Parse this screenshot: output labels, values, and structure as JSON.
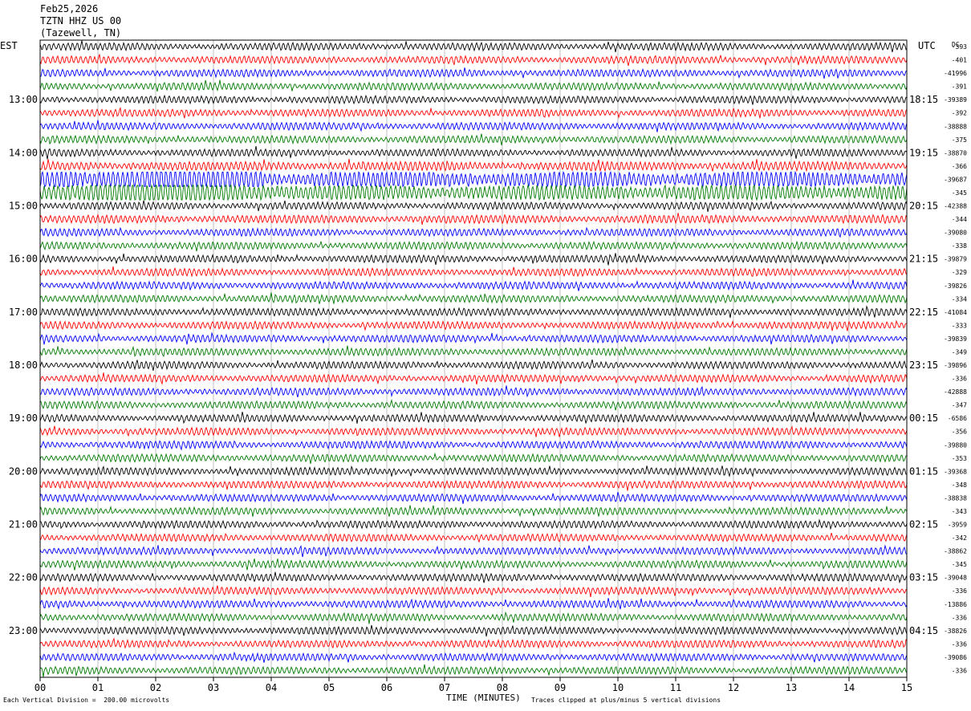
{
  "header": {
    "date": "Feb25,2026",
    "station": "TZTN HHZ US 00",
    "location": "(Tazewell, TN)"
  },
  "left_axis_label": "EST",
  "right_axis_label": "UTC",
  "dc_label": "DC",
  "footer": {
    "scale_text": "Each Vertical Division =  200.00 microvolts",
    "xlabel": "TIME (MINUTES)",
    "clip_text": "Traces clipped at plus/minus 5 vertical divisions"
  },
  "colors": {
    "trace_cycle": [
      "#000000",
      "#ff0000",
      "#0000ff",
      "#007a00"
    ],
    "grid": "#b0b0b0",
    "frame": "#000000"
  },
  "chart_data": {
    "type": "line",
    "title": "",
    "xlabel": "TIME (MINUTES)",
    "ylabel": "",
    "xlim": [
      0,
      15
    ],
    "x_ticks": [
      "00",
      "01",
      "02",
      "03",
      "04",
      "05",
      "06",
      "07",
      "08",
      "09",
      "10",
      "11",
      "12",
      "13",
      "14",
      "15"
    ],
    "vertical_grid": true,
    "rows_per_hour": 4,
    "minutes_per_row": 15,
    "left_time_labels": [
      {
        "row": 4,
        "label": "13:00"
      },
      {
        "row": 8,
        "label": "14:00"
      },
      {
        "row": 12,
        "label": "15:00"
      },
      {
        "row": 16,
        "label": "16:00"
      },
      {
        "row": 20,
        "label": "17:00"
      },
      {
        "row": 24,
        "label": "18:00"
      },
      {
        "row": 28,
        "label": "19:00"
      },
      {
        "row": 32,
        "label": "20:00"
      },
      {
        "row": 36,
        "label": "21:00"
      },
      {
        "row": 40,
        "label": "22:00"
      },
      {
        "row": 44,
        "label": "23:00"
      }
    ],
    "right_time_labels": [
      {
        "row": 4,
        "label": "18:15"
      },
      {
        "row": 8,
        "label": "19:15"
      },
      {
        "row": 12,
        "label": "20:15"
      },
      {
        "row": 16,
        "label": "21:15"
      },
      {
        "row": 20,
        "label": "22:15"
      },
      {
        "row": 24,
        "label": "23:15"
      },
      {
        "row": 28,
        "label": "00:15"
      },
      {
        "row": 32,
        "label": "01:15"
      },
      {
        "row": 36,
        "label": "02:15"
      },
      {
        "row": 40,
        "label": "03:15"
      },
      {
        "row": 44,
        "label": "04:15"
      }
    ],
    "dc_offsets": [
      "-393",
      "-401",
      "-41996",
      "-391",
      "-39389",
      "-392",
      "-38888",
      "-375",
      "-38870",
      "-366",
      "-39687",
      "-345",
      "-42388",
      "-344",
      "-39080",
      "-338",
      "-39879",
      "-329",
      "-39826",
      "-334",
      "-41084",
      "-333",
      "-39839",
      "-349",
      "-39896",
      "-336",
      "-42888",
      "-347",
      "-6586",
      "-356",
      "-39880",
      "-353",
      "-39368",
      "-348",
      "-38838",
      "-343",
      "-3959",
      "-342",
      "-38862",
      "-345",
      "-39048",
      "-336",
      "-13886",
      "-336",
      "-38826",
      "-336",
      "-39086",
      "-336"
    ],
    "row_amplitude": [
      1,
      1,
      1,
      1,
      1,
      1,
      1,
      1,
      1,
      1.2,
      2.2,
      2.1,
      1,
      1.1,
      1,
      1,
      1,
      1,
      1,
      1,
      1,
      1,
      1,
      1,
      1,
      1,
      1,
      1,
      1,
      1,
      1,
      1,
      1,
      1,
      1,
      1,
      1,
      1,
      1,
      1,
      1,
      1,
      1,
      1,
      1,
      1,
      1,
      1
    ]
  }
}
